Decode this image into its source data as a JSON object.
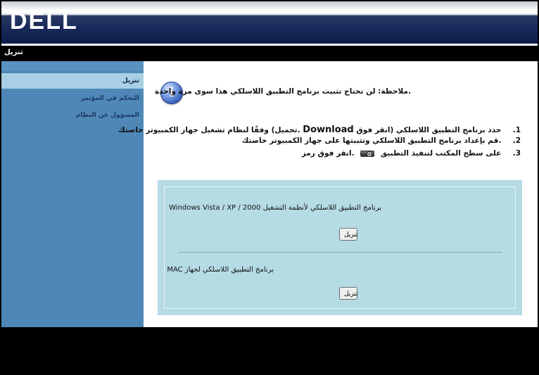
{
  "brand": {
    "logo_text": "DELL"
  },
  "title_bar": {
    "title": "تنزيل"
  },
  "sidebar": {
    "items": [
      {
        "label": "تنزيل",
        "active": true
      },
      {
        "label": "التحكم في المؤتمر",
        "active": false
      },
      {
        "label": "المسؤول عن النظام",
        "active": false
      }
    ]
  },
  "main": {
    "note": ".ملاحظة: لن تحتاج تثبيت برنامج التطبيق اللاسلكي هذا سوى مرة واحدة",
    "steps": [
      {
        "num": "1.",
        "before": ".تحميل) وفقًا لنظام تشغيل جهاز الكمبيوتر خاصتك",
        "emph": "Download",
        "after": "حدد برنامج التطبيق اللاسلكي (انقر فوق"
      },
      {
        "num": "2.",
        "text": ".قم بإعداد برنامج التطبيق اللاسلكي وتثبيتها على جهاز الكمبيوتر خاصتك"
      },
      {
        "num": "3.",
        "before": ".انقر فوق رمز",
        "after": "على سطح المكتب لتنفيذ التطبيق"
      }
    ],
    "downloads": {
      "windows_label": "برنامج التطبيق اللاسلكي لأنظمة التشغيل Windows Vista / XP / 2000",
      "mac_label": "برنامج التطبيق اللاسلكي لجهاز MAC",
      "button_label": "تنزيل"
    }
  },
  "colors": {
    "header_dark": "#0d1c48",
    "sidebar": "#4f88b7",
    "sidebar_active": "#a8cfe3",
    "panel": "#b5dbe5",
    "info_icon": "#2d57b3"
  },
  "icons": {
    "info": "info-icon",
    "projector": "projector-icon"
  }
}
